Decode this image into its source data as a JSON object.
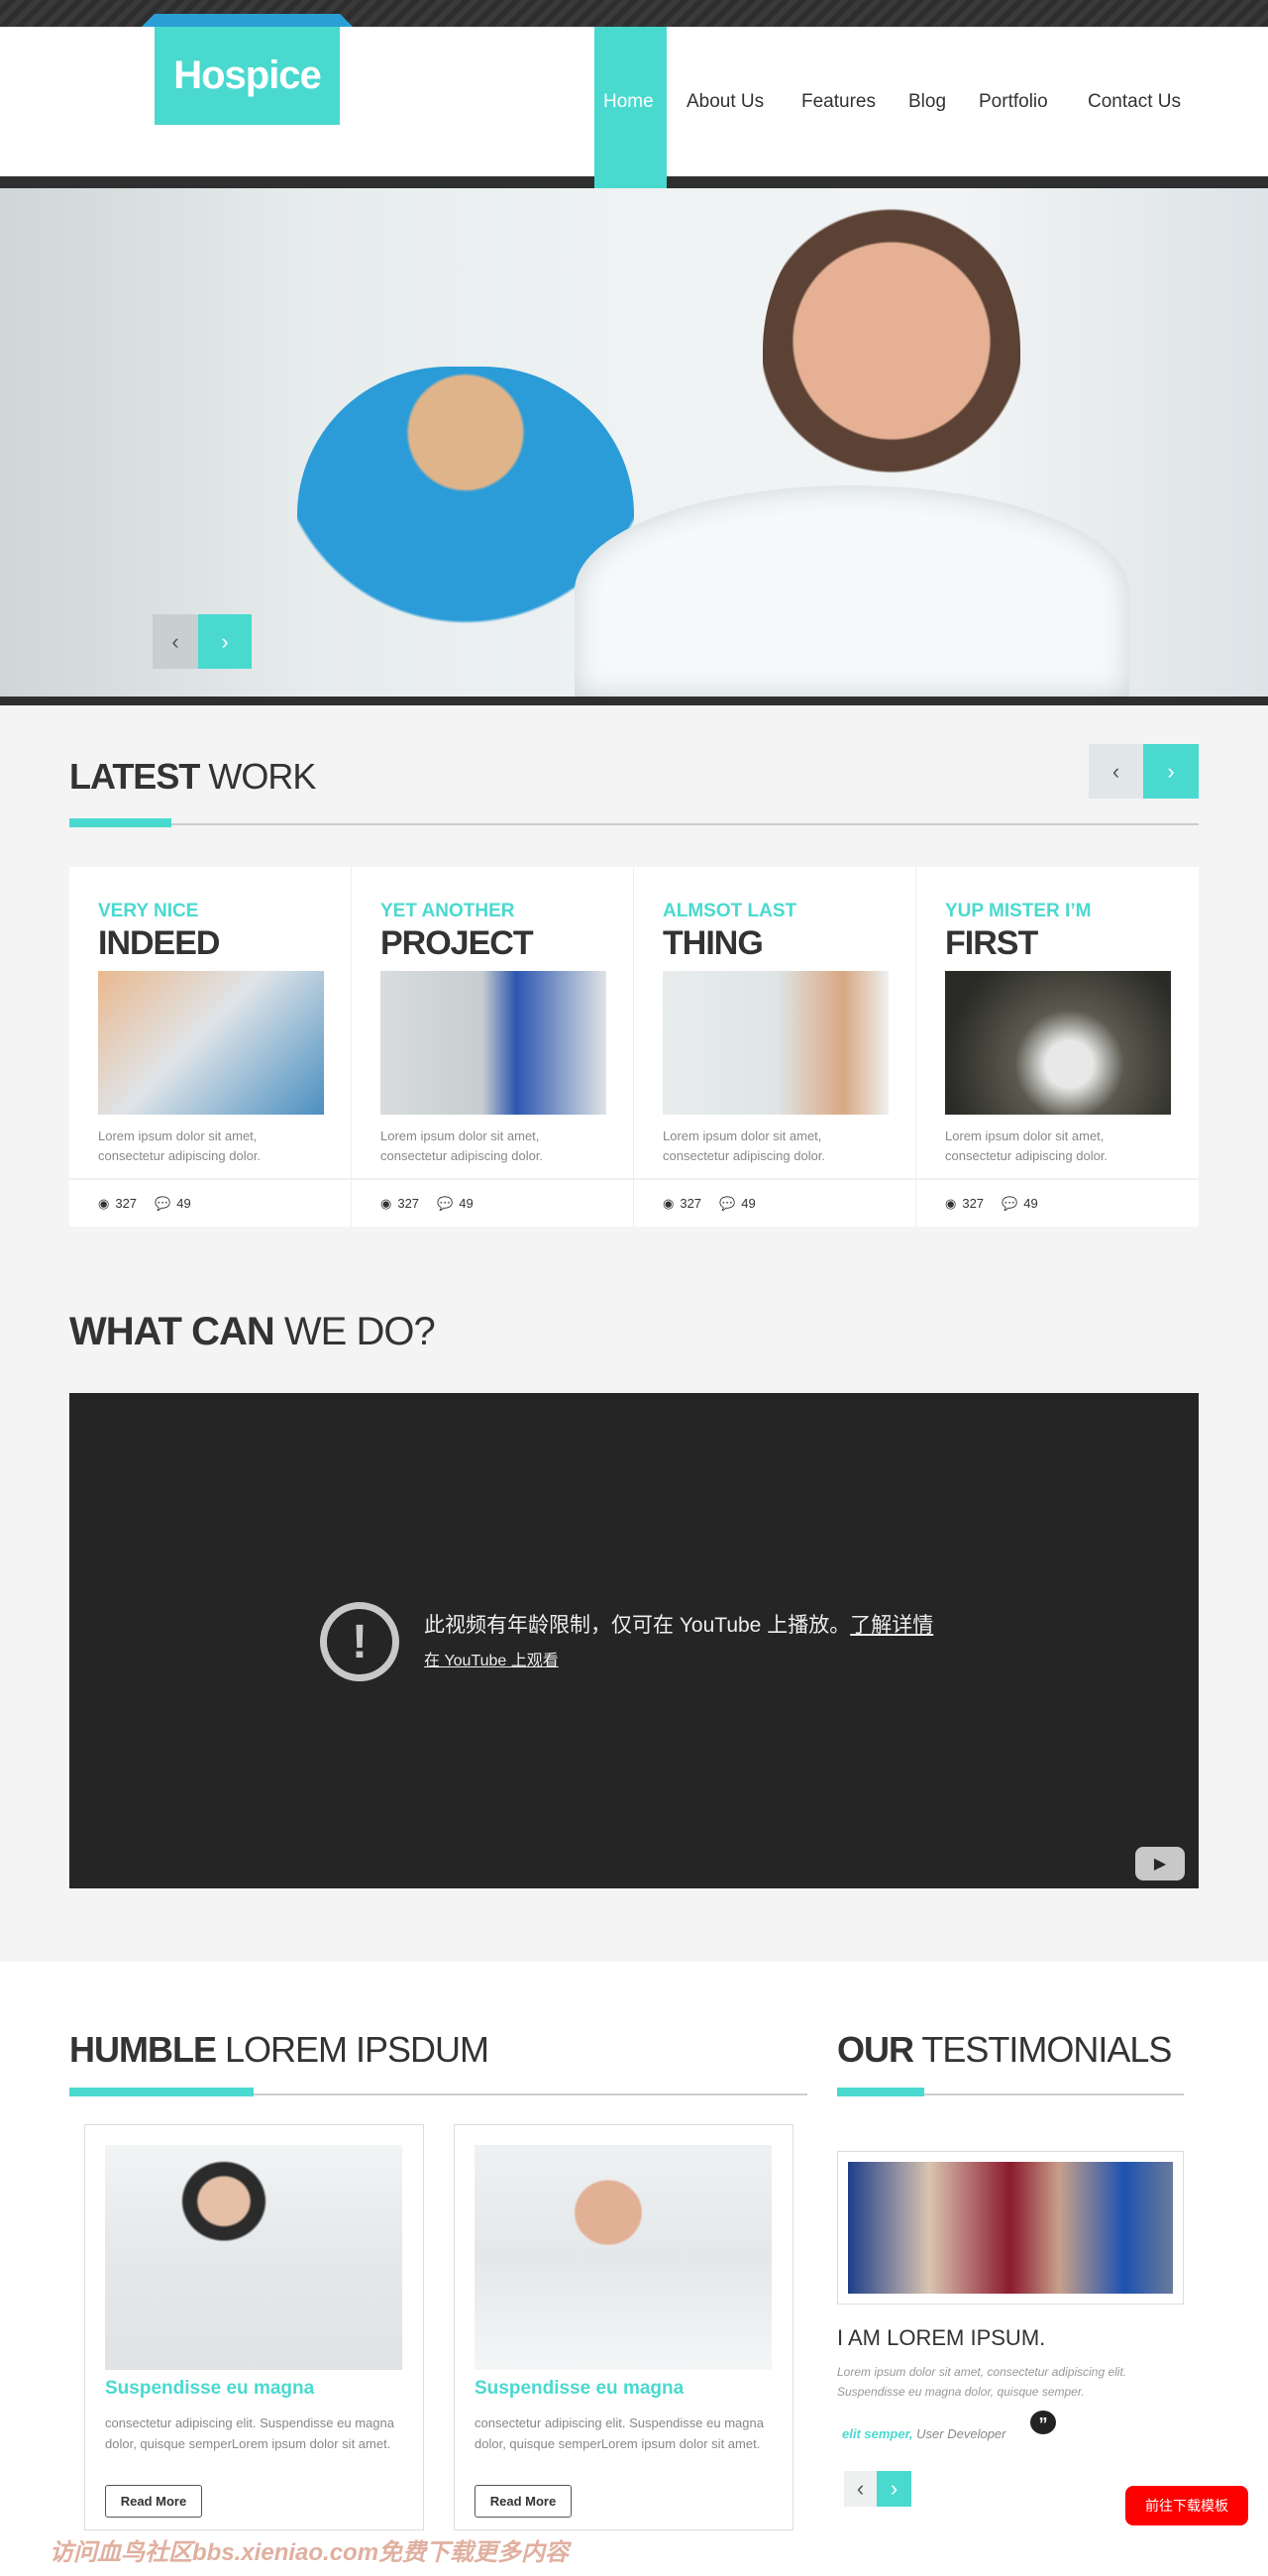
{
  "header": {
    "logo": "Hospice",
    "nav": [
      "Home",
      "About Us",
      "Features",
      "Blog",
      "Portfolio",
      "Contact Us"
    ],
    "active": "Home"
  },
  "colors": {
    "accent": "#4ad9cf",
    "dark": "#2f2f2f",
    "download_button": "#ff0000"
  },
  "latest_work": {
    "title_bold": "LATEST",
    "title_light": "WORK",
    "cards": [
      {
        "subtitle": "VERY NICE",
        "title": "INDEED",
        "text": "Lorem ipsum dolor sit amet, consectetur adipiscing dolor.",
        "views": "327",
        "comments": "49"
      },
      {
        "subtitle": "YET ANOTHER",
        "title": "PROJECT",
        "text": "Lorem ipsum dolor sit amet, consectetur adipiscing dolor.",
        "views": "327",
        "comments": "49"
      },
      {
        "subtitle": "ALMSOT LAST",
        "title": "THING",
        "text": "Lorem ipsum dolor sit amet, consectetur adipiscing dolor.",
        "views": "327",
        "comments": "49"
      },
      {
        "subtitle": "YUP MISTER I’M",
        "title": "FIRST",
        "text": "Lorem ipsum dolor sit amet, consectetur adipiscing dolor.",
        "views": "327",
        "comments": "49"
      }
    ]
  },
  "what_can": {
    "title_bold": "WHAT CAN",
    "title_light": "WE DO?",
    "video": {
      "message": "此视频有年龄限制，仅可在 YouTube 上播放。",
      "learn_more": "了解详情",
      "watch_link": "在 YouTube 上观看"
    }
  },
  "humble": {
    "title_bold": "HUMBLE",
    "title_light": "LOREM IPSDUM",
    "cards": [
      {
        "title": "Suspendisse eu magna",
        "text": "consectetur adipiscing elit. Suspendisse eu magna dolor, quisque semperLorem ipsum dolor sit amet.",
        "button": "Read More"
      },
      {
        "title": "Suspendisse eu magna",
        "text": "consectetur adipiscing elit. Suspendisse eu magna dolor, quisque semperLorem ipsum dolor sit amet.",
        "button": "Read More"
      }
    ]
  },
  "testimonials": {
    "title_bold": "OUR",
    "title_light": "TESTIMONIALS",
    "heading": "I AM LOREM IPSUM.",
    "quote": "Lorem ipsum dolor sit amet, consectetur adipiscing elit. Suspendisse eu magna dolor, quisque semper.",
    "author": "elit semper,",
    "role": "User Developer"
  },
  "download_button": "前往下载模板",
  "watermark": "访问血鸟社区bbs.xieniao.com免费下载更多内容"
}
